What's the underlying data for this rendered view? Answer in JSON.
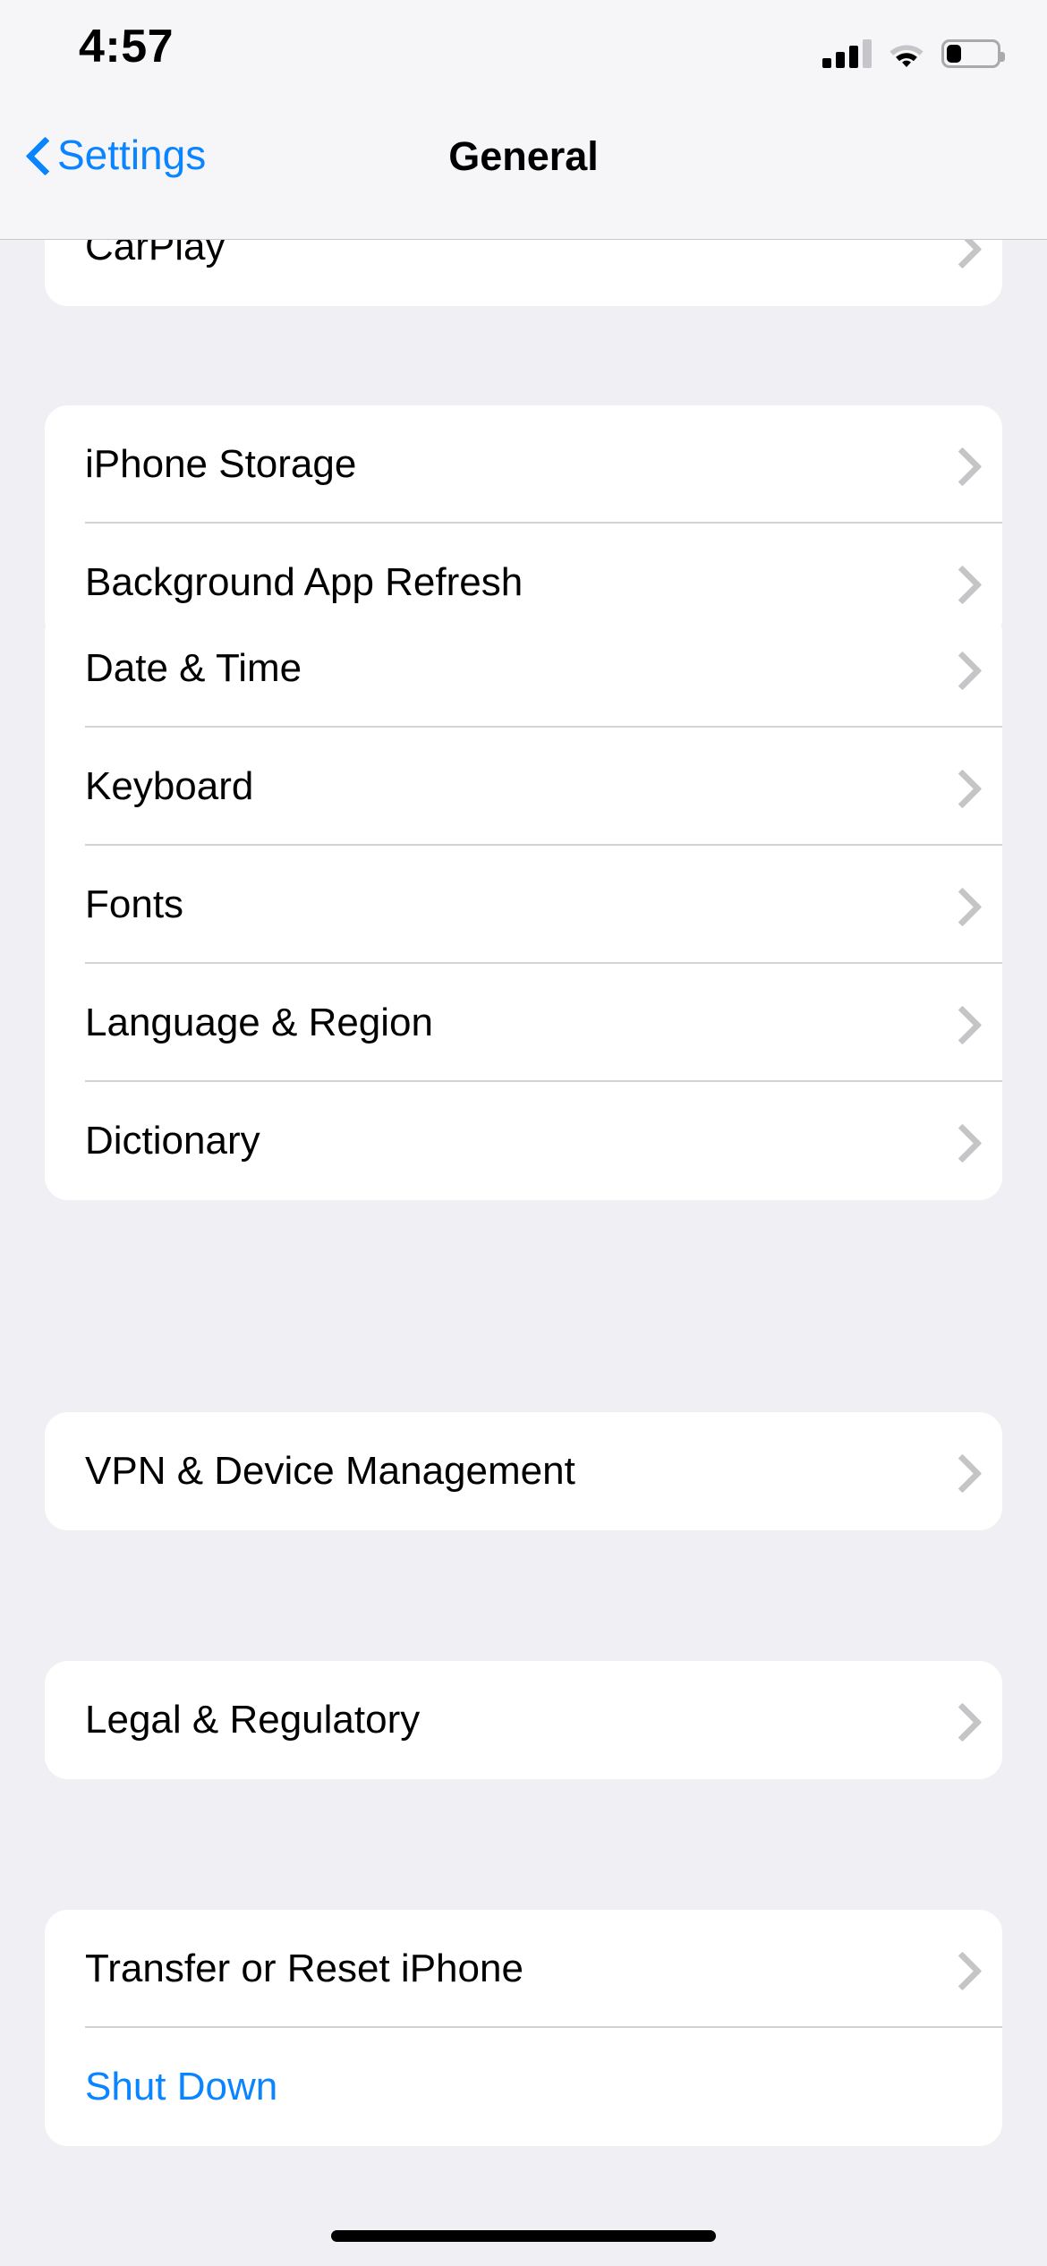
{
  "status_bar": {
    "time": "4:57",
    "cellular_icon": "cellular-signal-icon",
    "cellular_bars_filled": 3,
    "cellular_bars_total": 4,
    "wifi_icon": "wifi-icon",
    "wifi_strength": "weak",
    "battery_icon": "battery-icon",
    "battery_level_percent": 30
  },
  "nav_bar": {
    "back_icon": "chevron-left-icon",
    "back_label": "Settings",
    "title": "General"
  },
  "colors": {
    "accent_blue": "#0A84FF",
    "page_background": "#F0F0F4",
    "card_background": "#FFFFFF",
    "bar_background": "#F6F6F8",
    "separator": "#D3D3D6",
    "chevron": "#C5C5C7",
    "label_primary": "#000000"
  },
  "groups": [
    {
      "name": "carplay-group",
      "clipped_top": true,
      "rows": [
        {
          "label": "CarPlay",
          "accessory": "chevron-right-icon",
          "style": "default"
        }
      ]
    },
    {
      "name": "storage-group",
      "clipped_top": false,
      "rows": [
        {
          "label": "iPhone Storage",
          "accessory": "chevron-right-icon",
          "style": "default"
        },
        {
          "label": "Background App Refresh",
          "accessory": "chevron-right-icon",
          "style": "default"
        }
      ]
    },
    {
      "name": "locale-group",
      "clipped_top": false,
      "rows": [
        {
          "label": "Date & Time",
          "accessory": "chevron-right-icon",
          "style": "default"
        },
        {
          "label": "Keyboard",
          "accessory": "chevron-right-icon",
          "style": "default"
        },
        {
          "label": "Fonts",
          "accessory": "chevron-right-icon",
          "style": "default"
        },
        {
          "label": "Language & Region",
          "accessory": "chevron-right-icon",
          "style": "default"
        },
        {
          "label": "Dictionary",
          "accessory": "chevron-right-icon",
          "style": "default"
        }
      ]
    },
    {
      "name": "vpn-group",
      "clipped_top": false,
      "rows": [
        {
          "label": "VPN & Device Management",
          "accessory": "chevron-right-icon",
          "style": "default"
        }
      ]
    },
    {
      "name": "legal-group",
      "clipped_top": false,
      "rows": [
        {
          "label": "Legal & Regulatory",
          "accessory": "chevron-right-icon",
          "style": "default"
        }
      ]
    },
    {
      "name": "reset-group",
      "clipped_top": false,
      "rows": [
        {
          "label": "Transfer or Reset iPhone",
          "accessory": "chevron-right-icon",
          "style": "default"
        },
        {
          "label": "Shut Down",
          "accessory": "none",
          "style": "blue"
        }
      ]
    }
  ],
  "home_indicator": {
    "name": "home-indicator"
  }
}
